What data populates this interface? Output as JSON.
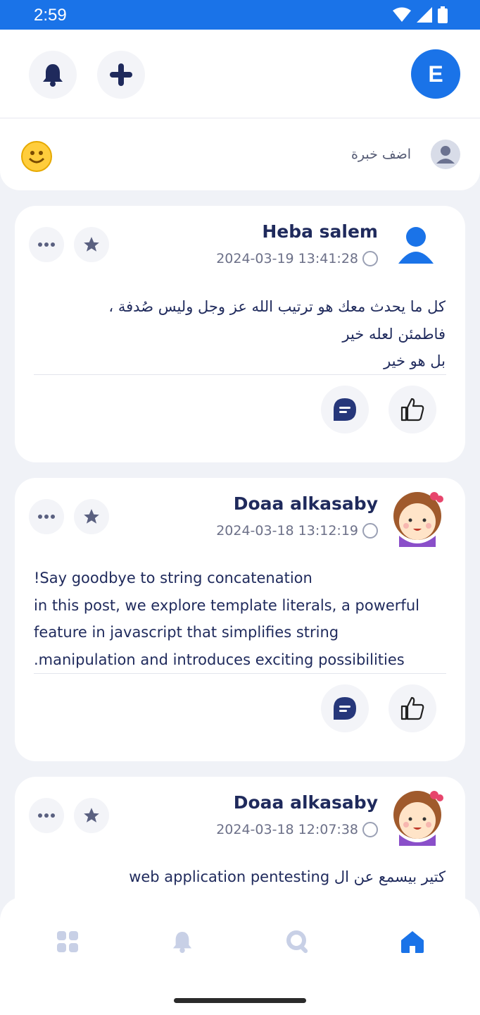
{
  "status_bar": {
    "time": "2:59"
  },
  "header": {
    "profile_initial": "E",
    "icons": [
      "bell-icon",
      "plus-icon"
    ]
  },
  "composer": {
    "placeholder": "اضف خبرة",
    "emoji": "😊"
  },
  "posts": [
    {
      "author": "Heba salem",
      "date": "2024-03-19 13:41:28",
      "body_lines": [
        "كل ما يحدث معك هو ترتيب الله عز وجل وليس صُدفة ،",
        "فاطمئن لعله خير",
        "بل هو خير"
      ]
    },
    {
      "author": "Doaa alkasaby",
      "date": "2024-03-18 13:12:19",
      "body_lines": [
        "!Say goodbye to string concatenation",
        "in this post, we explore template literals, a powerful",
        "feature in javascript that simplifies string",
        ".manipulation and introduces exciting possibilities"
      ]
    },
    {
      "author": "Doaa alkasaby",
      "date": "2024-03-18 12:07:38",
      "body_lines": [
        "كتير بيسمع عن ال web application pentesting"
      ]
    }
  ],
  "colors": {
    "primary": "#1a73e8",
    "navy": "#1f2a5c",
    "background": "#f0f2f7",
    "muted_icon": "#c8d0e6"
  },
  "bottom_nav": [
    "grid-icon",
    "bell-icon",
    "search-icon",
    "home-icon"
  ]
}
